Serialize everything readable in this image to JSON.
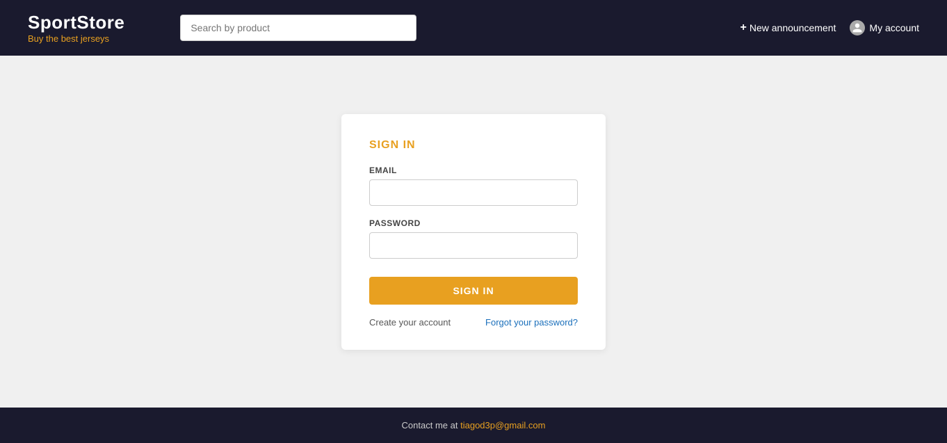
{
  "header": {
    "logo_title": "SportStore",
    "logo_subtitle": "Buy the best jerseys",
    "search_placeholder": "Search by product",
    "new_announcement_label": "New announcement",
    "my_account_label": "My account",
    "plus_symbol": "+"
  },
  "signin_card": {
    "title": "SIGN IN",
    "email_label": "EMAIL",
    "password_label": "PASSWORD",
    "signin_button_label": "SIGN IN",
    "create_account_label": "Create your account",
    "forgot_password_label": "Forgot your password?"
  },
  "footer": {
    "contact_text": "Contact me at",
    "email": "tiagod3p@gmail.com"
  }
}
